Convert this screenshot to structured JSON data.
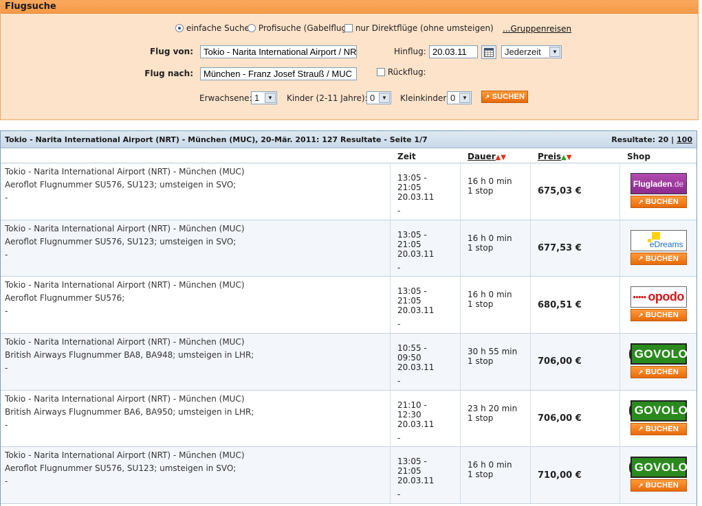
{
  "search": {
    "title": "Flugsuche",
    "options": {
      "simple": "einfache Suche",
      "pro": "Profisuche (Gabelflug)",
      "direct": "nur Direktflüge (ohne umsteigen)",
      "groups": "...Gruppenreisen"
    },
    "from_label": "Flug von:",
    "from_value": "Tokio - Narita International Airport / NRT",
    "to_label": "Flug nach:",
    "to_value": "München - Franz Josef Strauß / MUC",
    "outbound_label": "Hinflug:",
    "outbound_date": "20.03.11",
    "outbound_time": "Jederzeit",
    "return_label": "Rückflug:",
    "adults_label": "Erwachsene:",
    "adults_value": "1",
    "children_label": "Kinder (2-11 Jahre):",
    "children_value": "0",
    "infants_label": "Kleinkinder:",
    "infants_value": "0",
    "search_button": "SUCHEN"
  },
  "results": {
    "summary": "Tokio - Narita International Airport (NRT) - München (MUC), 20-Mär. 2011: 127 Resultate - Seite 1/7",
    "per_page_label": "Resultate: 20",
    "per_page_sep": "|",
    "per_page_alt": "100",
    "columns": {
      "time": "Zeit",
      "duration": "Dauer",
      "price": "Preis",
      "shop": "Shop"
    },
    "rows": [
      {
        "route": "Tokio - Narita International Airport (NRT) - München (MUC)",
        "detail": "Aeroflot Flugnummer SU576, SU123; umsteigen in SVO;",
        "extra": "-",
        "time": "13:05 - 21:05",
        "date": "20.03.11",
        "dash": "-",
        "duration": "16 h 0 min",
        "stops": "1 stop",
        "price": "675,03 €",
        "shop": "flugladen",
        "buy": "BUCHEN"
      },
      {
        "route": "Tokio - Narita International Airport (NRT) - München (MUC)",
        "detail": "Aeroflot Flugnummer SU576, SU123; umsteigen in SVO;",
        "extra": "-",
        "time": "13:05 - 21:05",
        "date": "20.03.11",
        "dash": "-",
        "duration": "16 h 0 min",
        "stops": "1 stop",
        "price": "677,53 €",
        "shop": "edreams",
        "buy": "BUCHEN"
      },
      {
        "route": "Tokio - Narita International Airport (NRT) - München (MUC)",
        "detail": "Aeroflot Flugnummer SU576;",
        "extra": "-",
        "time": "13:05 - 21:05",
        "date": "20.03.11",
        "dash": "-",
        "duration": "16 h 0 min",
        "stops": "1 stop",
        "price": "680,51 €",
        "shop": "opodo",
        "buy": "BUCHEN"
      },
      {
        "route": "Tokio - Narita International Airport (NRT) - München (MUC)",
        "detail": "British Airways Flugnummer BA8, BA948; umsteigen in LHR;",
        "extra": "-",
        "time": "10:55 - 09:50",
        "date": "20.03.11",
        "dash": "-",
        "duration": "30 h 55 min",
        "stops": "1 stop",
        "price": "706,00 €",
        "shop": "govolo",
        "buy": "BUCHEN"
      },
      {
        "route": "Tokio - Narita International Airport (NRT) - München (MUC)",
        "detail": "British Airways Flugnummer BA6, BA950; umsteigen in LHR;",
        "extra": "-",
        "time": "21:10 - 12:30",
        "date": "20.03.11",
        "dash": "-",
        "duration": "23 h 20 min",
        "stops": "1 stop",
        "price": "706,00 €",
        "shop": "govolo",
        "buy": "BUCHEN"
      },
      {
        "route": "Tokio - Narita International Airport (NRT) - München (MUC)",
        "detail": "Aeroflot Flugnummer SU576, SU123; umsteigen in SVO;",
        "extra": "-",
        "time": "13:05 - 21:05",
        "date": "20.03.11",
        "dash": "-",
        "duration": "16 h 0 min",
        "stops": "1 stop",
        "price": "710,00 €",
        "shop": "govolo",
        "buy": "BUCHEN"
      }
    ]
  },
  "logos": {
    "flugladen_a": "Flugladen",
    "flugladen_b": ".de",
    "edreams": "eDreams",
    "opodo": "opodo",
    "govolo": "GOVOLO"
  },
  "colors": {
    "accent": "#f59a48",
    "panel": "#fde3ca",
    "button": "#e86a0a",
    "header": "#c9d8e8"
  }
}
